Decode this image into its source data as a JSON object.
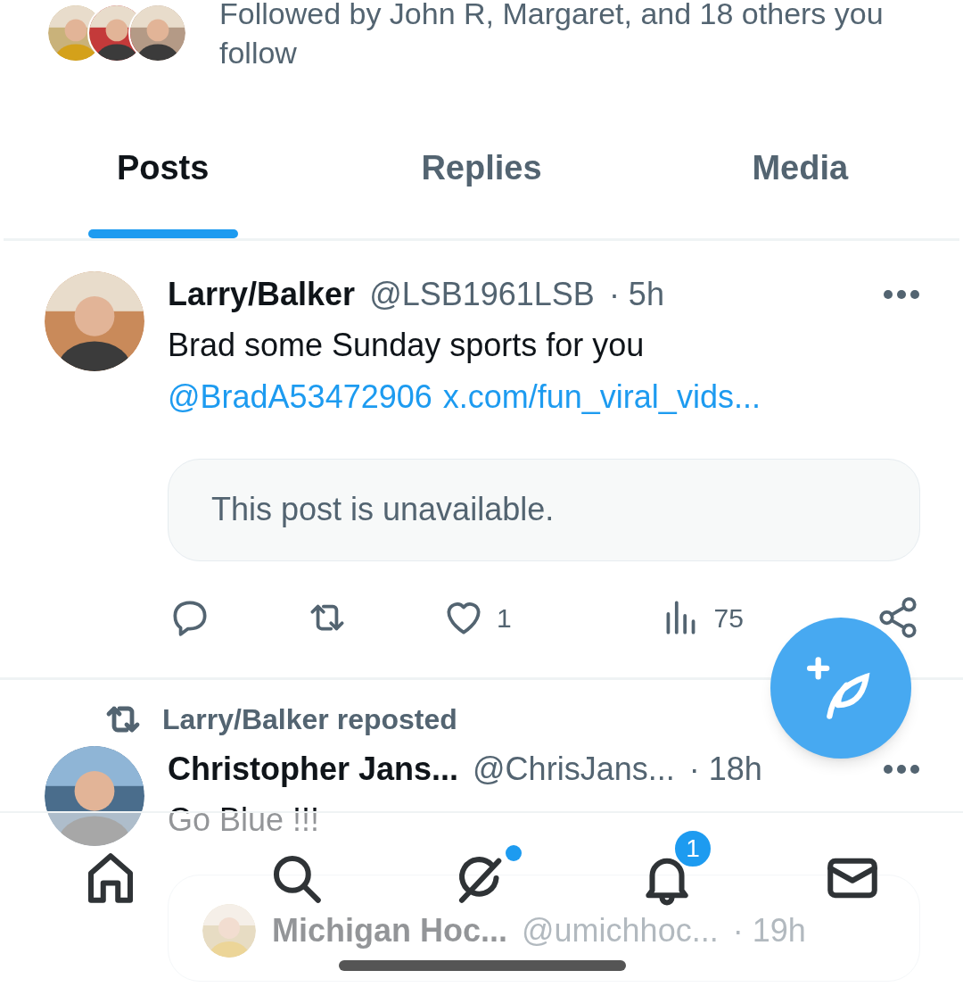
{
  "followed_by": "Followed by John R, Margaret, and 18 others you follow",
  "tabs": [
    {
      "label": "Posts",
      "selected": true
    },
    {
      "label": "Replies",
      "selected": false
    },
    {
      "label": "Media",
      "selected": false
    }
  ],
  "posts": [
    {
      "author": "Larry/Balker",
      "handle": "@LSB1961LSB",
      "time": "· 5h",
      "text": "Brad some Sunday sports for you",
      "mention": "@BradA53472906",
      "link": "x.com/fun_viral_vids...",
      "quote": {
        "kind": "unavailable",
        "text": "This post is unavailable."
      },
      "likes": "1",
      "views": "75"
    },
    {
      "repost_label": "Larry/Balker reposted",
      "author": "Christopher Jans...",
      "handle": "@ChrisJans...",
      "time": "· 18h",
      "text": "Go Blue !!!",
      "quote": {
        "kind": "post",
        "author": "Michigan Hoc...",
        "handle": "@umichhoc...",
        "time": "· 19h"
      }
    }
  ],
  "nav": [
    {
      "kind": "home",
      "dot": false
    },
    {
      "kind": "search",
      "dot": false
    },
    {
      "kind": "grok",
      "dot": true
    },
    {
      "kind": "notifications",
      "dot": false,
      "badge": "1"
    },
    {
      "kind": "messages",
      "dot": false
    }
  ]
}
